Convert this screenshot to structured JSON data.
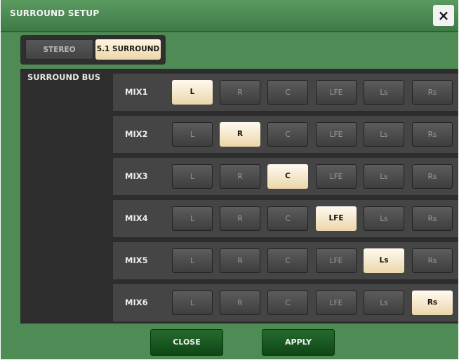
{
  "window": {
    "title": "SURROUND SETUP",
    "close_icon": "×"
  },
  "mode": {
    "stereo_label": "STEREO",
    "surround_label": "5.1 SURROUND",
    "selected": "5.1 SURROUND"
  },
  "surround_bus": {
    "label": "SURROUND BUS",
    "channels": [
      "L",
      "R",
      "C",
      "LFE",
      "Ls",
      "Rs"
    ],
    "rows": [
      {
        "label": "MIX1",
        "selected": "L"
      },
      {
        "label": "MIX2",
        "selected": "R"
      },
      {
        "label": "MIX3",
        "selected": "C"
      },
      {
        "label": "MIX4",
        "selected": "LFE"
      },
      {
        "label": "MIX5",
        "selected": "Ls"
      },
      {
        "label": "MIX6",
        "selected": "Rs"
      }
    ]
  },
  "footer": {
    "close_label": "CLOSE",
    "apply_label": "APPLY"
  },
  "colors": {
    "window_bg": "#4f8b55",
    "selected_button": "#f5e3c0",
    "footer_button": "#1a5a21"
  }
}
